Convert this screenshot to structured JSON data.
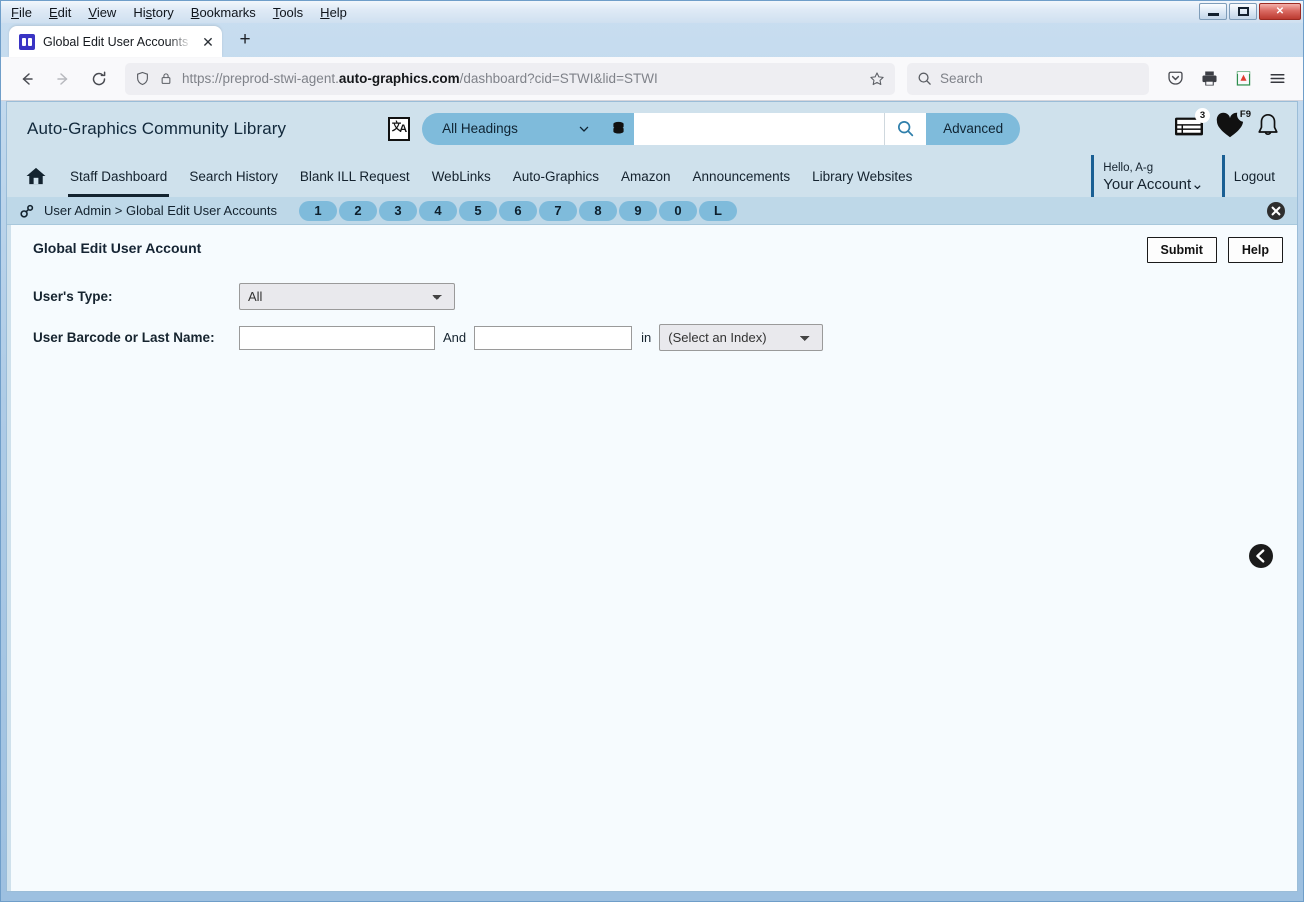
{
  "browser": {
    "menus": [
      "File",
      "Edit",
      "View",
      "History",
      "Bookmarks",
      "Tools",
      "Help"
    ],
    "window_controls": {
      "minimize": "minimize-icon",
      "restore": "restore-icon",
      "close": "✕"
    },
    "tab": {
      "title": "Global Edit User Accounts | STW",
      "favicon": "agent-favicon",
      "close": "✕",
      "newtab": "+"
    },
    "nav": {
      "back": "back-arrow-icon",
      "forward": "forward-arrow-icon",
      "reload": "reload-icon"
    },
    "url": {
      "shield": "shield-icon",
      "lock": "lock-icon",
      "prefix": "https://preprod-stwi-agent.",
      "domain": "auto-graphics.com",
      "suffix": "/dashboard?cid=STWI&lid=STWI",
      "bookmark": "star-icon"
    },
    "search": {
      "placeholder": "Search",
      "icon": "search-icon"
    },
    "toolbar_icons": [
      "pocket-icon",
      "print-icon",
      "extension-icon",
      "hamburger-menu-icon"
    ]
  },
  "app": {
    "brand": "Auto-Graphics Community Library",
    "language_icon": "language-toggle-icon",
    "search": {
      "scope_selected": "All Headings",
      "scope_caret": "chevron-down-icon",
      "database_icon": "database-stack-icon",
      "input_value": "",
      "go_icon": "search-icon",
      "advanced_label": "Advanced"
    },
    "header_icons": [
      {
        "name": "my-lists-icon",
        "badge": "3"
      },
      {
        "name": "favorites-heart-icon",
        "badge": "F9"
      },
      {
        "name": "notifications-bell-icon",
        "badge": ""
      }
    ],
    "nav": {
      "home_icon": "home-icon",
      "items": [
        {
          "label": "Staff Dashboard",
          "active": true
        },
        {
          "label": "Search History",
          "active": false
        },
        {
          "label": "Blank ILL Request",
          "active": false
        },
        {
          "label": "WebLinks",
          "active": false
        },
        {
          "label": "Auto-Graphics",
          "active": false
        },
        {
          "label": "Amazon",
          "active": false
        },
        {
          "label": "Announcements",
          "active": false
        },
        {
          "label": "Library Websites",
          "active": false
        }
      ]
    },
    "account": {
      "greeting": "Hello, A-g",
      "label": "Your Account",
      "caret": "⌄",
      "logout": "Logout"
    },
    "breadcrumb": {
      "icon": "link-chain-icon",
      "text": "User Admin > Global Edit User Accounts",
      "pills": [
        "1",
        "2",
        "3",
        "4",
        "5",
        "6",
        "7",
        "8",
        "9",
        "0",
        "L"
      ],
      "close_icon": "close-circle-icon"
    }
  },
  "page": {
    "title": "Global Edit User Account",
    "submit_label": "Submit",
    "help_label": "Help",
    "fields": {
      "user_type": {
        "label": "User's Type:",
        "value": "All",
        "options": [
          "All"
        ]
      },
      "barcode_or_name": {
        "label": "User Barcode or Last Name:",
        "value_1": "",
        "value_2": "",
        "conjunction": "And",
        "preposition": "in",
        "index_value": "(Select an Index)",
        "index_options": [
          "(Select an Index)"
        ]
      }
    },
    "collapse_icon": "chevron-left-circle-icon"
  },
  "colors": {
    "header_band": "#cfe1ec",
    "accent_blue": "#7fbbdb",
    "crumb_band": "#bed8e8",
    "content_bg": "#f6fbfe",
    "active_underline": "#13232f"
  }
}
